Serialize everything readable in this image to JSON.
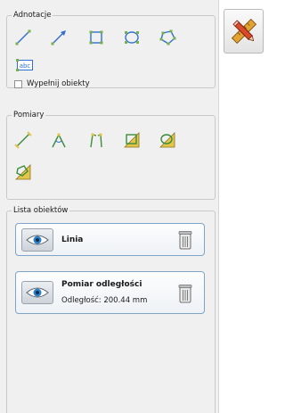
{
  "annotations": {
    "title": "Adnotacje",
    "tools": [
      {
        "icon": "line-icon"
      },
      {
        "icon": "arrow-icon"
      },
      {
        "icon": "rectangle-icon"
      },
      {
        "icon": "ellipse-icon"
      },
      {
        "icon": "polygon-icon"
      },
      {
        "icon": "text-icon",
        "text": "abc"
      }
    ],
    "fill_checkbox_label": "Wypełnij obiekty",
    "fill_checked": false
  },
  "measurements": {
    "title": "Pomiary",
    "tools": [
      {
        "icon": "distance-icon"
      },
      {
        "icon": "angle-icon"
      },
      {
        "icon": "double-angle-icon"
      },
      {
        "icon": "area-rectangle-icon"
      },
      {
        "icon": "area-ellipse-icon"
      },
      {
        "icon": "area-polygon-icon"
      }
    ]
  },
  "objects": {
    "title": "Lista obiektów",
    "items": [
      {
        "name": "Linia",
        "detail": ""
      },
      {
        "name": "Pomiar odległości",
        "detail": "Odległość: 200.44 mm"
      }
    ]
  },
  "side_button_icon": "pencil-ruler-icon",
  "colors": {
    "accent": "#2f6fcf",
    "measure_yellow": "#e3c54a",
    "measure_green": "#3c8c3c"
  }
}
